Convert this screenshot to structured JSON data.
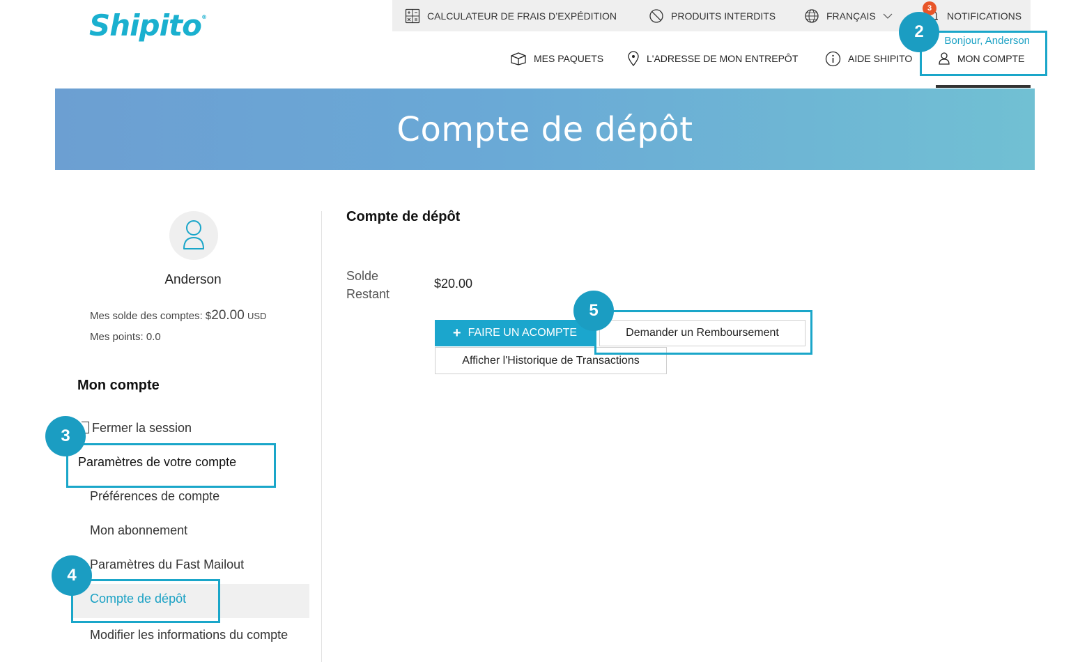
{
  "brand": {
    "name": "Shipito",
    "mark": "®",
    "color": "#1ab0cf"
  },
  "topbar": {
    "calculator": "CALCULATEUR DE FRAIS D’EXPÉDITION",
    "prohibited": "PRODUITS INTERDITS",
    "language": "FRANÇAIS",
    "notifications": "NOTIFICATIONS",
    "notification_count": "3"
  },
  "nav": {
    "packages": "MES PAQUETS",
    "warehouse": "L'ADRESSE DE MON ENTREPÔT",
    "help": "AIDE SHIPITO",
    "greeting": "Bonjour, Anderson",
    "account": "MON COMPTE"
  },
  "hero": {
    "title": "Compte de dépôt"
  },
  "profile": {
    "username": "Anderson",
    "balance_prefix": "Mes solde des comptes: $",
    "balance_amount": "20.00",
    "balance_currency": "USD",
    "points": "Mes points: 0.0"
  },
  "sidebar": {
    "heading": "Mon compte",
    "items": [
      {
        "label": "Fermer la session"
      },
      {
        "label": "Paramètres de votre compte"
      },
      {
        "label": "Préférences de compte"
      },
      {
        "label": "Mon abonnement"
      },
      {
        "label": "Paramètres du Fast Mailout"
      },
      {
        "label": "Compte de dépôt",
        "active": true
      },
      {
        "label": "Modifier les informations du compte"
      }
    ]
  },
  "main": {
    "title": "Compte de dépôt",
    "balance_label": "Solde Restant",
    "balance_value": "$20.00",
    "deposit_button": "FAIRE UN ACOMPTE",
    "refund_button": "Demander un Remboursement",
    "history_button": "Afficher l'Historique de Transactions"
  },
  "annotations": {
    "m2": "2",
    "m3": "3",
    "m4": "4",
    "m5": "5"
  },
  "colors": {
    "accent": "#1ba6cd",
    "highlight": "#1aa6c9",
    "marker": "#1b9dc2",
    "badge": "#e85528"
  }
}
